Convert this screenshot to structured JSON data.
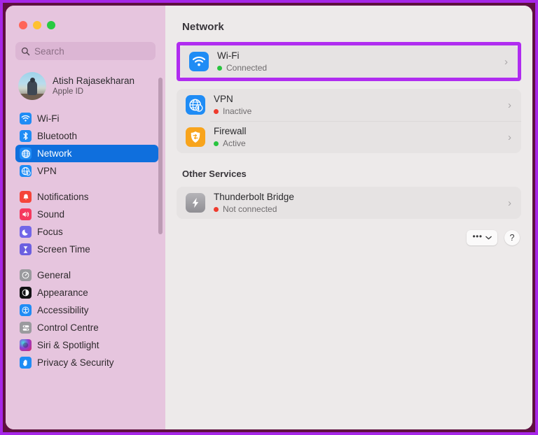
{
  "window": {
    "traffic_lights": [
      {
        "name": "close",
        "color": "#ff6458"
      },
      {
        "name": "minimize",
        "color": "#ffc130"
      },
      {
        "name": "zoom",
        "color": "#28ca42"
      }
    ]
  },
  "sidebar": {
    "search": {
      "placeholder": "Search",
      "value": ""
    },
    "account": {
      "name": "Atish Rajasekharan",
      "subtitle": "Apple ID"
    },
    "groups": [
      {
        "items": [
          {
            "label": "Wi-Fi",
            "icon": "wifi-icon",
            "selected": false
          },
          {
            "label": "Bluetooth",
            "icon": "bluetooth-icon",
            "selected": false
          },
          {
            "label": "Network",
            "icon": "network-globe-icon",
            "selected": true
          },
          {
            "label": "VPN",
            "icon": "vpn-icon",
            "selected": false
          }
        ]
      },
      {
        "items": [
          {
            "label": "Notifications",
            "icon": "bell-icon",
            "selected": false
          },
          {
            "label": "Sound",
            "icon": "speaker-icon",
            "selected": false
          },
          {
            "label": "Focus",
            "icon": "moon-icon",
            "selected": false
          },
          {
            "label": "Screen Time",
            "icon": "hourglass-icon",
            "selected": false
          }
        ]
      },
      {
        "items": [
          {
            "label": "General",
            "icon": "gear-icon",
            "selected": false
          },
          {
            "label": "Appearance",
            "icon": "appearance-icon",
            "selected": false
          },
          {
            "label": "Accessibility",
            "icon": "accessibility-icon",
            "selected": false
          },
          {
            "label": "Control Centre",
            "icon": "control-centre-icon",
            "selected": false
          },
          {
            "label": "Siri & Spotlight",
            "icon": "siri-icon",
            "selected": false
          },
          {
            "label": "Privacy & Security",
            "icon": "hand-icon",
            "selected": false
          }
        ]
      }
    ]
  },
  "main": {
    "title": "Network",
    "highlighted_service": {
      "name": "Wi-Fi",
      "status": "Connected",
      "status_color": "#29c43f",
      "icon": "wifi-icon"
    },
    "services": [
      {
        "name": "VPN",
        "status": "Inactive",
        "status_color": "#ef3b2d",
        "icon": "vpn-icon"
      },
      {
        "name": "Firewall",
        "status": "Active",
        "status_color": "#29c43f",
        "icon": "firewall-shield-icon"
      }
    ],
    "other_services_title": "Other Services",
    "other_services": [
      {
        "name": "Thunderbolt Bridge",
        "status": "Not connected",
        "status_color": "#ef3b2d",
        "icon": "thunderbolt-icon"
      }
    ],
    "footer": {
      "more_label": "•••",
      "help_label": "?"
    },
    "chevron": "›"
  },
  "annotation": {
    "highlight_color": "#b02cf0"
  }
}
